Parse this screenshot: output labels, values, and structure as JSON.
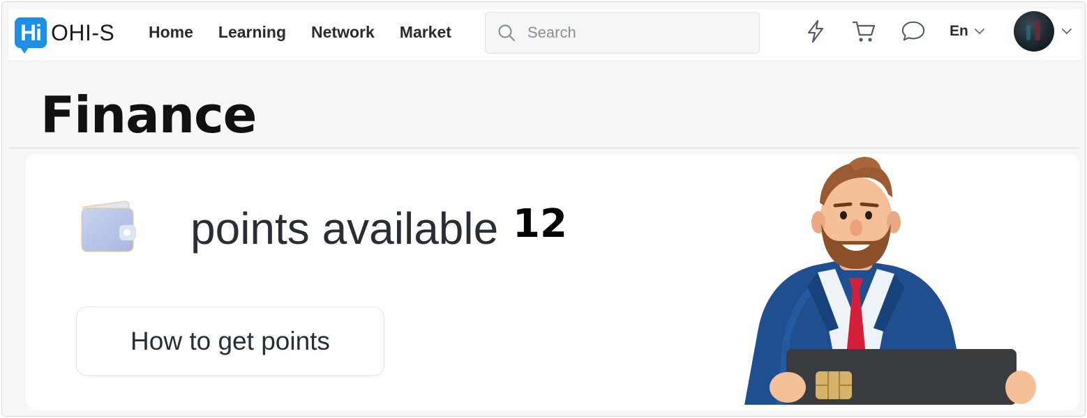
{
  "app": {
    "logo_badge": "Hi",
    "logo_text": "OHI-S",
    "brand_color": "#1f8fe6"
  },
  "nav": {
    "items": [
      {
        "label": "Home"
      },
      {
        "label": "Learning"
      },
      {
        "label": "Network"
      },
      {
        "label": "Market"
      }
    ]
  },
  "search": {
    "placeholder": "Search",
    "value": ""
  },
  "header_icons": [
    "lightning-icon",
    "cart-icon",
    "chat-icon"
  ],
  "language": {
    "selected": "En"
  },
  "page": {
    "title": "Finance"
  },
  "points": {
    "label": "points available",
    "value": "12",
    "how_button": "How to get points"
  }
}
